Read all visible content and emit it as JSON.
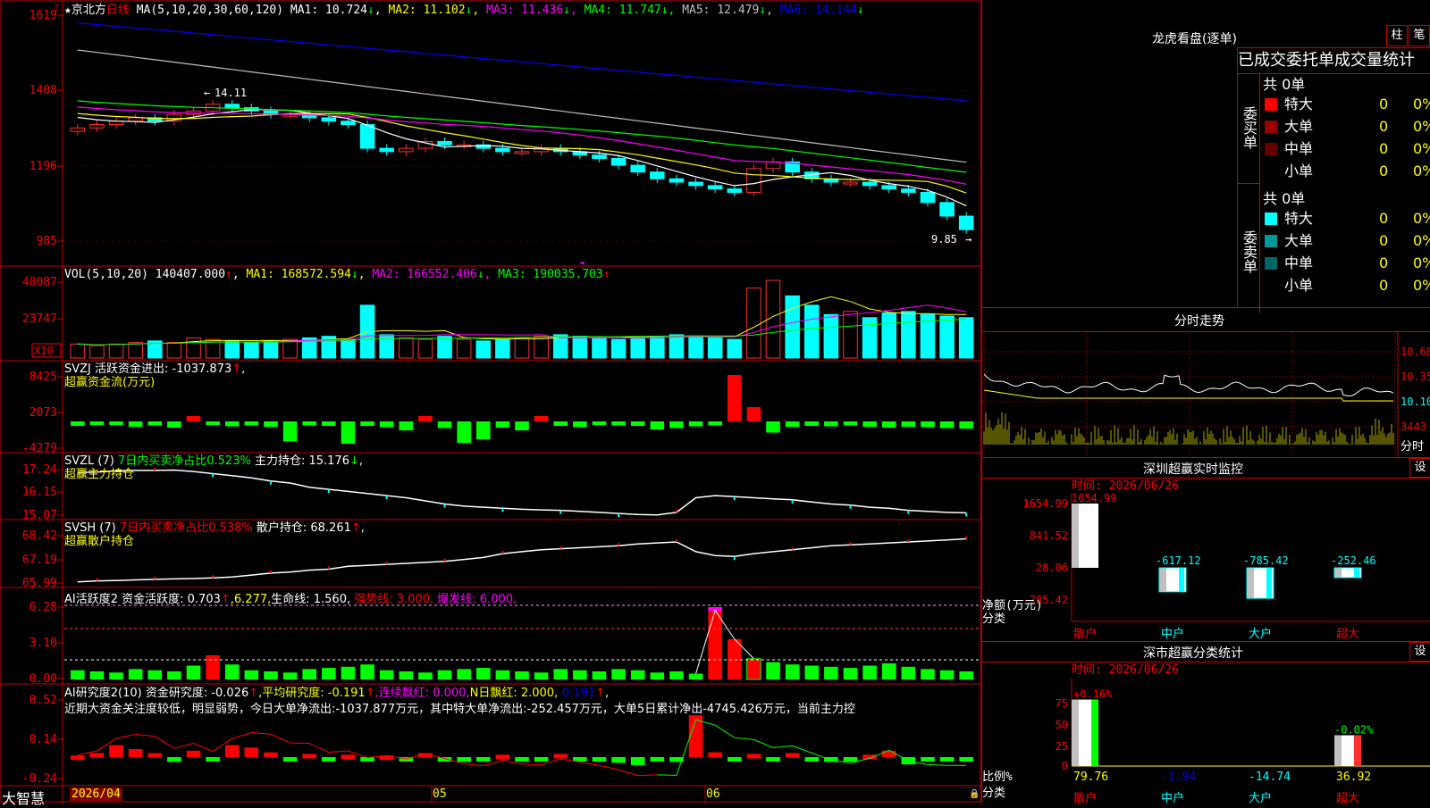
{
  "stock": {
    "star": "★",
    "name": "京北方",
    "period": "日线"
  },
  "price_panel": {
    "ma_header": "MA(5,10,20,30,60,120)",
    "ma": [
      {
        "label": "MA1:",
        "value": "10.724",
        "arrow": "↓",
        "color": "#ffffff"
      },
      {
        "label": "MA2:",
        "value": "11.102",
        "arrow": "↓",
        "color": "#ffff00"
      },
      {
        "label": "MA3:",
        "value": "11.436",
        "arrow": "↓",
        "color": "#ff00ff"
      },
      {
        "label": "MA4:",
        "value": "11.747",
        "arrow": "↓",
        "color": "#00ff00"
      },
      {
        "label": "MA5:",
        "value": "12.479",
        "arrow": "↓",
        "color": "#c0c0c0"
      },
      {
        "label": "MA6:",
        "value": "14.144",
        "arrow": "↓",
        "color": "#0000ff"
      }
    ],
    "yticks": [
      "1619",
      "1408",
      "1196",
      "985"
    ],
    "high_mark": "14.11",
    "low_mark": "9.85"
  },
  "vol_panel": {
    "header": "VOL(5,10,20)",
    "value": "140407.000",
    "value_arrow": "↑",
    "ma": [
      {
        "label": "MA1:",
        "value": "168572.594",
        "arrow": "↓",
        "color": "#ffff00"
      },
      {
        "label": "MA2:",
        "value": "166552.406",
        "arrow": "↓",
        "color": "#ff00ff"
      },
      {
        "label": "MA3:",
        "value": "190035.703",
        "arrow": "↑",
        "color": "#00ff00"
      }
    ],
    "yticks": [
      "48087",
      "23747"
    ],
    "unit": "X10"
  },
  "svzj_panel": {
    "line1": "SVZJ  活跃资金进出: -1037.873",
    "line1_arrow": "↑",
    "line1_tail": ",",
    "line2": "超赢资金流(万元)",
    "yticks": [
      "8425",
      "2073",
      "-4279"
    ]
  },
  "svzl_panel": {
    "head": "SVZL (7)",
    "red": "7日内买卖净占比0.523%",
    "white": "主力持仓: 15.176",
    "arrow": "↓",
    "tail": ",",
    "line2": "超赢主力持仓",
    "yticks": [
      "17.24",
      "16.15",
      "15.07"
    ]
  },
  "svsh_panel": {
    "head": "SVSH (7)",
    "red": "7日内买卖净占比0.538%",
    "white": "散户持仓: 68.261",
    "arrow": "↑",
    "tail": ",",
    "line2": "超赢散户持仓",
    "yticks": [
      "68.42",
      "67.19",
      "65.99"
    ]
  },
  "ai1_panel": {
    "head": "AI活跃度2 资金活跃度: 0.703",
    "arrow": "↑",
    "p2": ",6.277,",
    "p3": "生命线: 1.560,",
    "p4": "强势线: 3.000,",
    "p5": "爆发线: 6.000,",
    "yticks": [
      "6.28",
      "3.10",
      "0.00"
    ]
  },
  "ai2_panel": {
    "head": "AI研究度2(10) 资金研究度: -0.026",
    "arrow1": "↑",
    "p2": ",平均研究度: -0.191",
    "arrow2": "↑",
    "p3": ",连续飘红: 0.000,",
    "p4": "N日飘红: 2.000,",
    "p5": "-0.191",
    "arrow3": "↑",
    "p6": ",",
    "desc": "近期大资金关注度较低，明显弱势，今日大单净流出:-1037.877万元，其中特大单净流出:-252.457万元，大单5日累计净出-4745.426万元，当前主力控",
    "yticks": [
      "0.52",
      "0.14",
      "-0.24"
    ]
  },
  "bottom": {
    "brand": "大智慧",
    "date": "2026/04",
    "months": [
      "05",
      "06"
    ]
  },
  "dragon": {
    "title": "龙虎看盘(逐单)",
    "btn_bar": "柱",
    "btn_pen": "笔",
    "subtitle": "已成交委托单成交量统计",
    "buy": {
      "side": "委买单",
      "total": "共 0单",
      "rows": [
        {
          "label": "特大",
          "count": "0",
          "pct": "0%",
          "color": "#ff0000"
        },
        {
          "label": "大单",
          "count": "0",
          "pct": "0%",
          "color": "#990000"
        },
        {
          "label": "中单",
          "count": "0",
          "pct": "0%",
          "color": "#660000"
        },
        {
          "label": "小单",
          "count": "0",
          "pct": "0%",
          "color": "#000000"
        }
      ]
    },
    "sell": {
      "side": "委卖单",
      "total": "共 0单",
      "rows": [
        {
          "label": "特大",
          "count": "0",
          "pct": "0%",
          "color": "#00ffff"
        },
        {
          "label": "大单",
          "count": "0",
          "pct": "0%",
          "color": "#009999"
        },
        {
          "label": "中单",
          "count": "0",
          "pct": "0%",
          "color": "#006666"
        },
        {
          "label": "小单",
          "count": "0",
          "pct": "0%",
          "color": "#000000"
        }
      ]
    }
  },
  "intraday": {
    "title": "分时走势",
    "yticks": [
      "10.60",
      "10.35",
      "10.10",
      "3443"
    ],
    "label": "分时"
  },
  "sz_monitor": {
    "title": "深圳超赢实时监控",
    "btn": "设",
    "time": "时间: 2026/06/26",
    "yticks": [
      "1654.99",
      "841.52",
      "28.06",
      "-785.42"
    ],
    "ylabel": "净额(万元)",
    "xlabel": "分类",
    "categories": [
      "散户",
      "中户",
      "大户",
      "超大"
    ],
    "values": [
      1654.99,
      -617.12,
      -785.42,
      -252.46
    ]
  },
  "sh_stats": {
    "title": "深市超赢分类统计",
    "btn": "设",
    "time": "时间: 2026/06/26",
    "yticks": [
      "75",
      "50",
      "25",
      "0"
    ],
    "ylabel": "比例%",
    "xlabel": "分类",
    "categories": [
      "散户",
      "中户",
      "大户",
      "超大"
    ],
    "values": [
      79.76,
      -1.94,
      -14.74,
      36.92
    ],
    "top_labels": [
      "+0.16%",
      "",
      "",
      "-0.02%"
    ]
  },
  "chart_data": [
    {
      "type": "candlestick",
      "title": "京北方 日线",
      "ylabel": "",
      "yticks": [
        16.19,
        14.08,
        11.96,
        9.85
      ],
      "ylim": [
        9.5,
        16.4
      ],
      "annotations": [
        {
          "text": "14.11",
          "kind": "high"
        },
        {
          "text": "9.85",
          "kind": "low"
        }
      ],
      "close": [
        13.1,
        13.2,
        13.3,
        13.4,
        13.3,
        13.5,
        13.6,
        13.8,
        13.7,
        13.6,
        13.5,
        13.5,
        13.4,
        13.3,
        13.2,
        12.5,
        12.4,
        12.5,
        12.7,
        12.6,
        12.6,
        12.5,
        12.4,
        12.4,
        12.5,
        12.4,
        12.3,
        12.2,
        12.0,
        11.8,
        11.6,
        11.5,
        11.4,
        11.3,
        11.2,
        11.9,
        12.1,
        11.8,
        11.6,
        11.5,
        11.5,
        11.4,
        11.3,
        11.2,
        10.9,
        10.5,
        10.1
      ],
      "series": [
        {
          "name": "MA1",
          "color": "#ffffff"
        },
        {
          "name": "MA2",
          "color": "#ffff00"
        },
        {
          "name": "MA3",
          "color": "#ff00ff"
        },
        {
          "name": "MA4",
          "color": "#00ff00"
        },
        {
          "name": "MA5",
          "color": "#c0c0c0"
        },
        {
          "name": "MA6",
          "color": "#0000ff"
        }
      ]
    },
    {
      "type": "bar",
      "title": "VOL(5,10,20)",
      "values": [
        9,
        8,
        9,
        10,
        11,
        10,
        13,
        12,
        11,
        10,
        11,
        12,
        13,
        14,
        12,
        34,
        15,
        13,
        12,
        14,
        12,
        11,
        12,
        13,
        14,
        15,
        14,
        13,
        12,
        13,
        14,
        15,
        14,
        13,
        12,
        45,
        50,
        40,
        34,
        28,
        30,
        26,
        29,
        30,
        28,
        27,
        26
      ]
    },
    {
      "type": "bar",
      "title": "超赢资金流(万元)",
      "yticks": [
        8425,
        2073,
        -4279
      ],
      "values": [
        -10,
        -8,
        -6,
        -12,
        -9,
        -14,
        10,
        -8,
        -11,
        -9,
        -12,
        -45,
        -9,
        -10,
        -50,
        -10,
        -13,
        -20,
        10,
        -15,
        -48,
        -40,
        -14,
        -20,
        10,
        -10,
        -13,
        -8,
        -9,
        -10,
        -18,
        -15,
        -11,
        -9,
        8425,
        3000,
        -25,
        -12,
        -10,
        -11,
        -9,
        -12,
        -14,
        -12,
        -13,
        -15,
        -1037
      ]
    },
    {
      "type": "line",
      "title": "超赢主力持仓",
      "yticks": [
        17.24,
        16.15,
        15.07
      ],
      "values": [
        17.1,
        17.12,
        17.18,
        17.2,
        17.2,
        17.22,
        17.15,
        17.05,
        16.95,
        16.85,
        16.7,
        16.6,
        16.4,
        16.3,
        16.2,
        16.1,
        16.0,
        15.9,
        15.75,
        15.6,
        15.5,
        15.45,
        15.4,
        15.35,
        15.32,
        15.3,
        15.25,
        15.2,
        15.15,
        15.1,
        15.08,
        15.2,
        15.9,
        16.0,
        15.95,
        15.9,
        15.85,
        15.8,
        15.7,
        15.6,
        15.55,
        15.45,
        15.4,
        15.3,
        15.25,
        15.2,
        15.18
      ]
    },
    {
      "type": "line",
      "title": "超赢散户持仓",
      "yticks": [
        68.42,
        67.19,
        65.99
      ],
      "values": [
        66.05,
        66.1,
        66.12,
        66.15,
        66.18,
        66.2,
        66.22,
        66.25,
        66.3,
        66.4,
        66.5,
        66.55,
        66.65,
        66.7,
        66.85,
        66.9,
        66.95,
        67.0,
        67.05,
        67.1,
        67.2,
        67.3,
        67.5,
        67.6,
        67.7,
        67.75,
        67.8,
        67.85,
        67.9,
        68.0,
        68.05,
        68.1,
        67.6,
        67.4,
        67.35,
        67.5,
        67.6,
        67.7,
        67.8,
        67.9,
        67.95,
        68.0,
        68.05,
        68.1,
        68.15,
        68.2,
        68.26
      ]
    },
    {
      "type": "bar",
      "title": "AI活跃度2",
      "yticks": [
        6.28,
        3.1,
        0.0
      ],
      "values": [
        0.8,
        0.7,
        0.6,
        0.9,
        0.8,
        0.7,
        1.2,
        2.1,
        1.3,
        0.8,
        0.7,
        0.6,
        0.9,
        1.0,
        1.1,
        1.3,
        0.8,
        0.7,
        0.6,
        0.8,
        0.9,
        1.0,
        0.8,
        0.7,
        0.6,
        0.9,
        0.8,
        0.7,
        0.9,
        0.8,
        0.6,
        0.7,
        0.5,
        6.28,
        3.5,
        1.8,
        1.5,
        1.3,
        1.2,
        1.1,
        1.0,
        1.2,
        1.4,
        1.1,
        0.9,
        0.8,
        0.7
      ]
    },
    {
      "type": "bar",
      "title": "AI研究度2(10)",
      "yticks": [
        0.52,
        0.14,
        -0.24
      ],
      "values": [
        0.02,
        0.05,
        0.15,
        0.1,
        0.05,
        -0.06,
        0.08,
        -0.04,
        0.15,
        0.12,
        0.06,
        -0.02,
        0.04,
        -0.05,
        0.03,
        -0.05,
        0.02,
        -0.03,
        0.05,
        -0.04,
        -0.06,
        -0.04,
        0.03,
        -0.05,
        -0.03,
        0.04,
        -0.04,
        -0.05,
        -0.07,
        -0.1,
        -0.05,
        -0.06,
        0.52,
        0.06,
        -0.03,
        0.04,
        -0.03,
        0.05,
        -0.04,
        -0.06,
        -0.04,
        0.03,
        0.08,
        -0.09,
        -0.05,
        -0.03,
        -0.026
      ]
    }
  ]
}
